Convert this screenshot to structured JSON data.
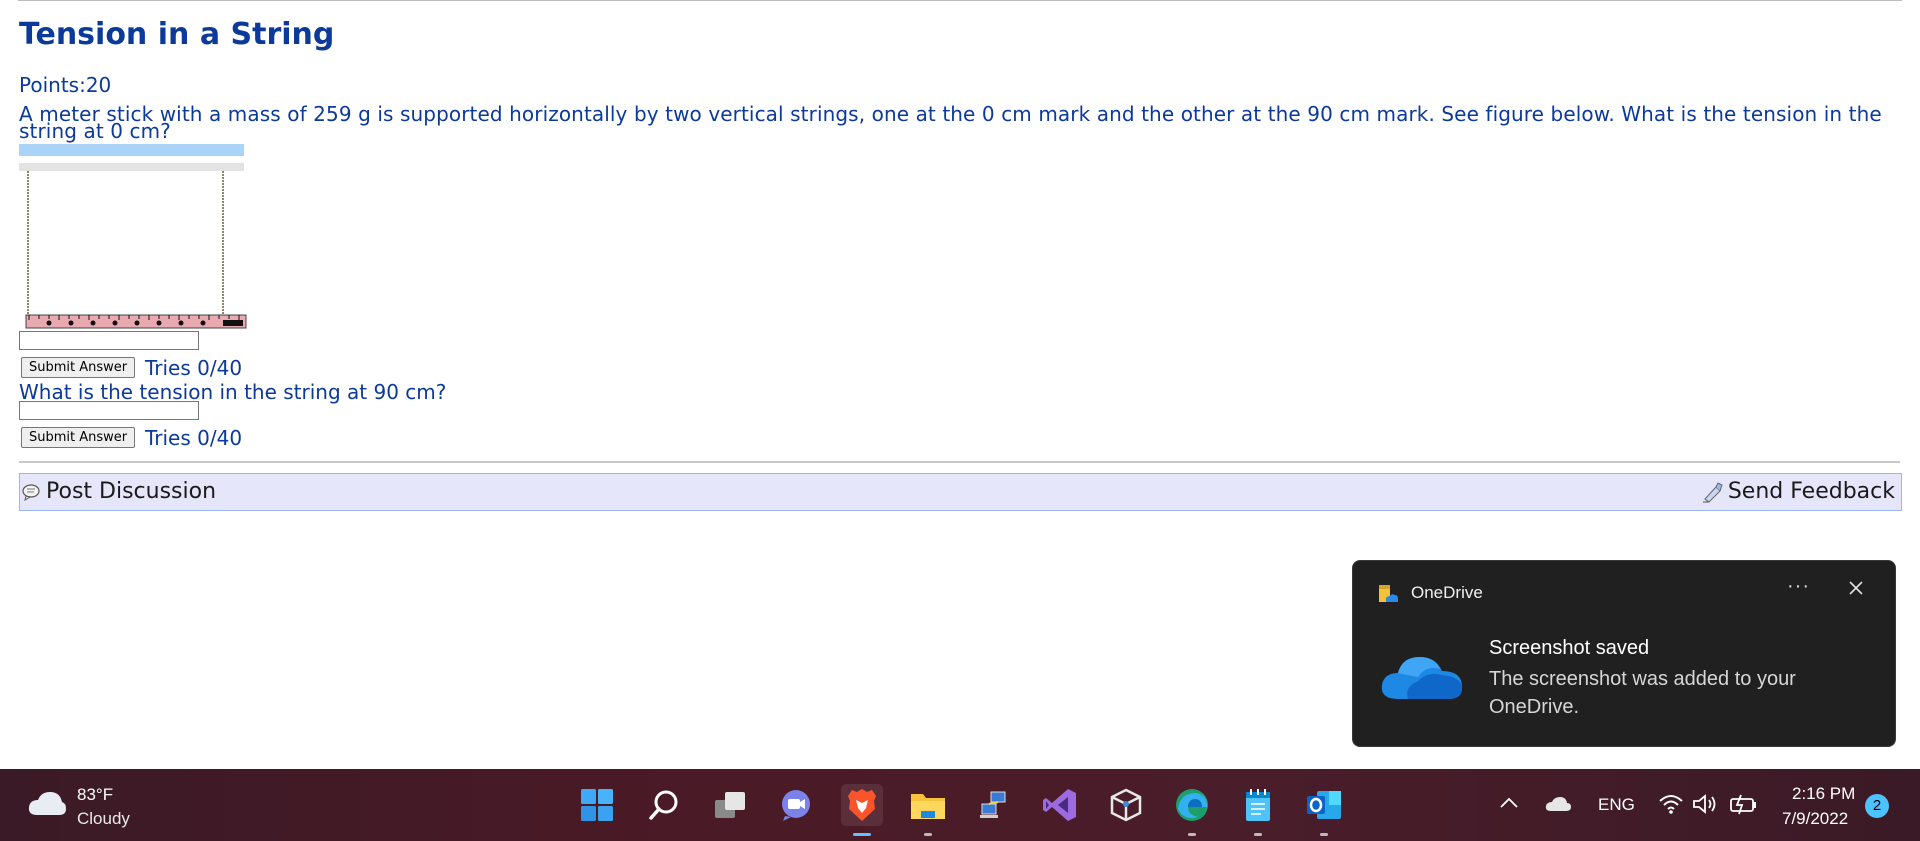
{
  "page": {
    "title": "Tension in a String",
    "points": "Points:20",
    "question1": "A meter stick with a mass of 259 g is supported horizontally by two vertical strings, one at the 0 cm mark and the other at the 90 cm mark. See figure below. What is the tension in the string at 0 cm?",
    "question2": "What is the tension in the string at 90 cm?",
    "submit_label": "Submit Answer",
    "tries1": "Tries 0/40",
    "tries2": "Tries 0/40",
    "answer1_value": "",
    "answer2_value": ""
  },
  "bar": {
    "post_discussion": "Post Discussion",
    "send_feedback": "Send Feedback"
  },
  "toast": {
    "app_name": "OneDrive",
    "more": "···",
    "title": "Screenshot saved",
    "body": "The screenshot was added to your OneDrive."
  },
  "taskbar": {
    "temperature": "83°F",
    "condition": "Cloudy",
    "lang": "ENG",
    "time": "2:16 PM",
    "date": "7/9/2022",
    "notifications": "2",
    "icons": [
      "windows-start-icon",
      "search-icon",
      "task-view-icon",
      "teams-chat-icon",
      "brave-browser-icon",
      "file-explorer-icon",
      "network-remote-icon",
      "visual-studio-icon",
      "virtualbox-icon",
      "edge-icon",
      "notepad-icon",
      "outlook-icon"
    ]
  },
  "colors": {
    "text_blue": "#0b3a9a",
    "bar_bg": "#e6e6fb",
    "toast_bg": "#202020",
    "taskbar_bg": "#4a1a26",
    "accent": "#5ec3ff"
  }
}
